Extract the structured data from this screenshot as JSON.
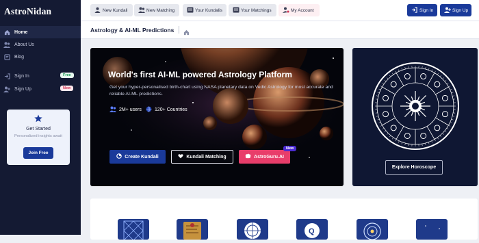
{
  "brand": "AstroNidan",
  "sidebar": {
    "items": [
      {
        "label": "Home",
        "icon": "home-icon"
      },
      {
        "label": "About Us",
        "icon": "users-icon"
      },
      {
        "label": "Blog",
        "icon": "blog-icon"
      },
      {
        "label": "Sign In",
        "icon": "sign-in-icon",
        "badge": "Free"
      },
      {
        "label": "Sign Up",
        "icon": "sign-up-icon",
        "badge": "New"
      }
    ],
    "get_started": {
      "title": "Get Started",
      "text": "Personalized insights await",
      "button": "Join Free"
    }
  },
  "topbar": {
    "tabs": [
      {
        "label": "New Kundali",
        "icon": "user-icon"
      },
      {
        "label": "New Matching",
        "icon": "users-icon"
      },
      {
        "label": "Your Kundalis",
        "icon": "list-icon"
      },
      {
        "label": "Your Matchings",
        "icon": "list-icon"
      },
      {
        "label": "My Account",
        "icon": "user-cog-icon"
      }
    ],
    "sign_in": "Sign In",
    "sign_up": "Sign Up"
  },
  "breadcrumb": {
    "title": "Astrology & AI-ML Predictions"
  },
  "hero": {
    "title": "World's first AI-ML powered Astrology Platform",
    "subtitle": "Get your hyper-personalised birth-chart using NASA planetary data on Vedic Astrology for most accurate and reliable AI-ML predictions.",
    "stats": [
      "2M+ users",
      "120+ Countries"
    ],
    "buttons": [
      "Create Kundali",
      "Kundali Matching",
      "AstroGuru.AI"
    ],
    "new_tag": "New"
  },
  "horoscope": {
    "button": "Explore Horoscope"
  },
  "colors": {
    "sidebar": "#141a33",
    "primary": "#1a3a9a",
    "accent": "#e83d6a",
    "hero_bg": "#04050b"
  }
}
